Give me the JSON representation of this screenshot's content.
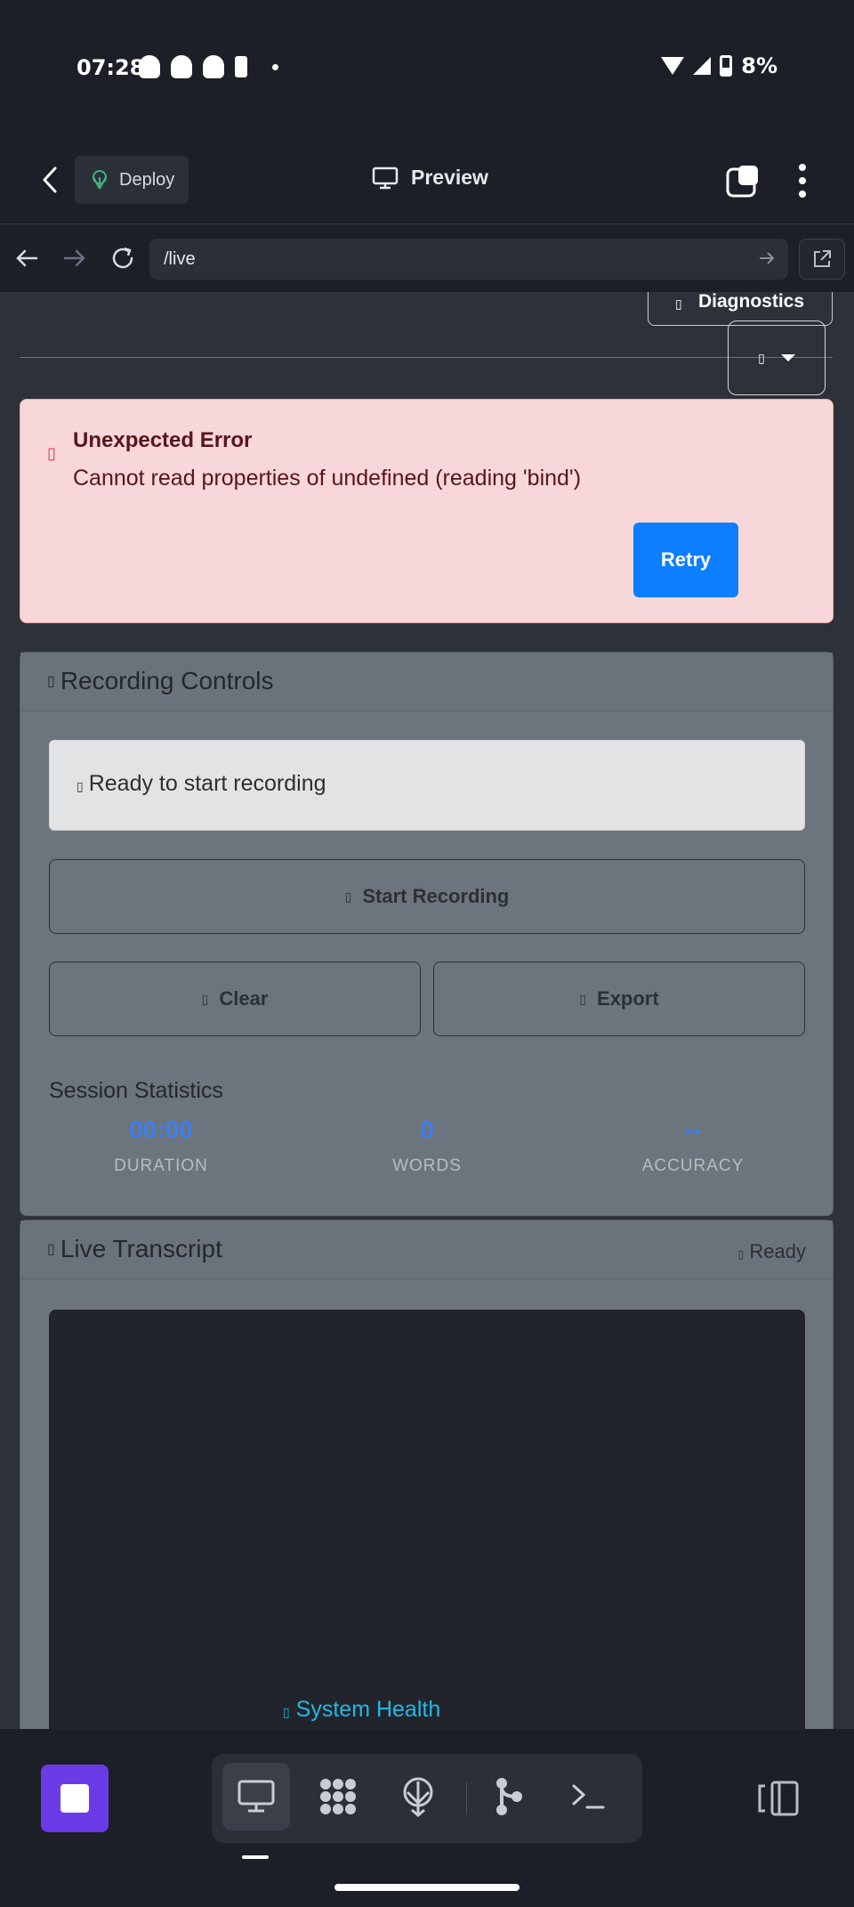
{
  "status_bar": {
    "time": "07:28",
    "battery": "8%"
  },
  "app_bar": {
    "deploy_label": "Deploy",
    "preview_label": "Preview"
  },
  "url_bar": {
    "url": "/live"
  },
  "page": {
    "diagnostics_label": "Diagnostics",
    "glyph": "▯",
    "error": {
      "title": "Unexpected Error",
      "message": "Cannot read properties of undefined (reading 'bind')",
      "retry_label": "Retry"
    },
    "recording": {
      "title": "Recording Controls",
      "status": "Ready to start recording",
      "start_label": "Start Recording",
      "clear_label": "Clear",
      "export_label": "Export",
      "stats_title": "Session Statistics",
      "stats": [
        {
          "value": "00:00",
          "label": "DURATION"
        },
        {
          "value": "0",
          "label": "WORDS"
        },
        {
          "value": "--",
          "label": "ACCURACY"
        }
      ]
    },
    "transcript": {
      "title": "Live Transcript",
      "status": "Ready"
    },
    "system_health": "System Health"
  },
  "colors": {
    "accent": "#0d7efd",
    "stop": "#6c3be8",
    "error_bg": "#f8d7da",
    "stat_value": "#3d7ef0",
    "health": "#22b8e6"
  },
  "bottom_bar": {
    "tools": [
      "monitor-icon",
      "apps-grid-icon",
      "deploy-icon",
      "git-branch-icon",
      "terminal-icon"
    ]
  }
}
